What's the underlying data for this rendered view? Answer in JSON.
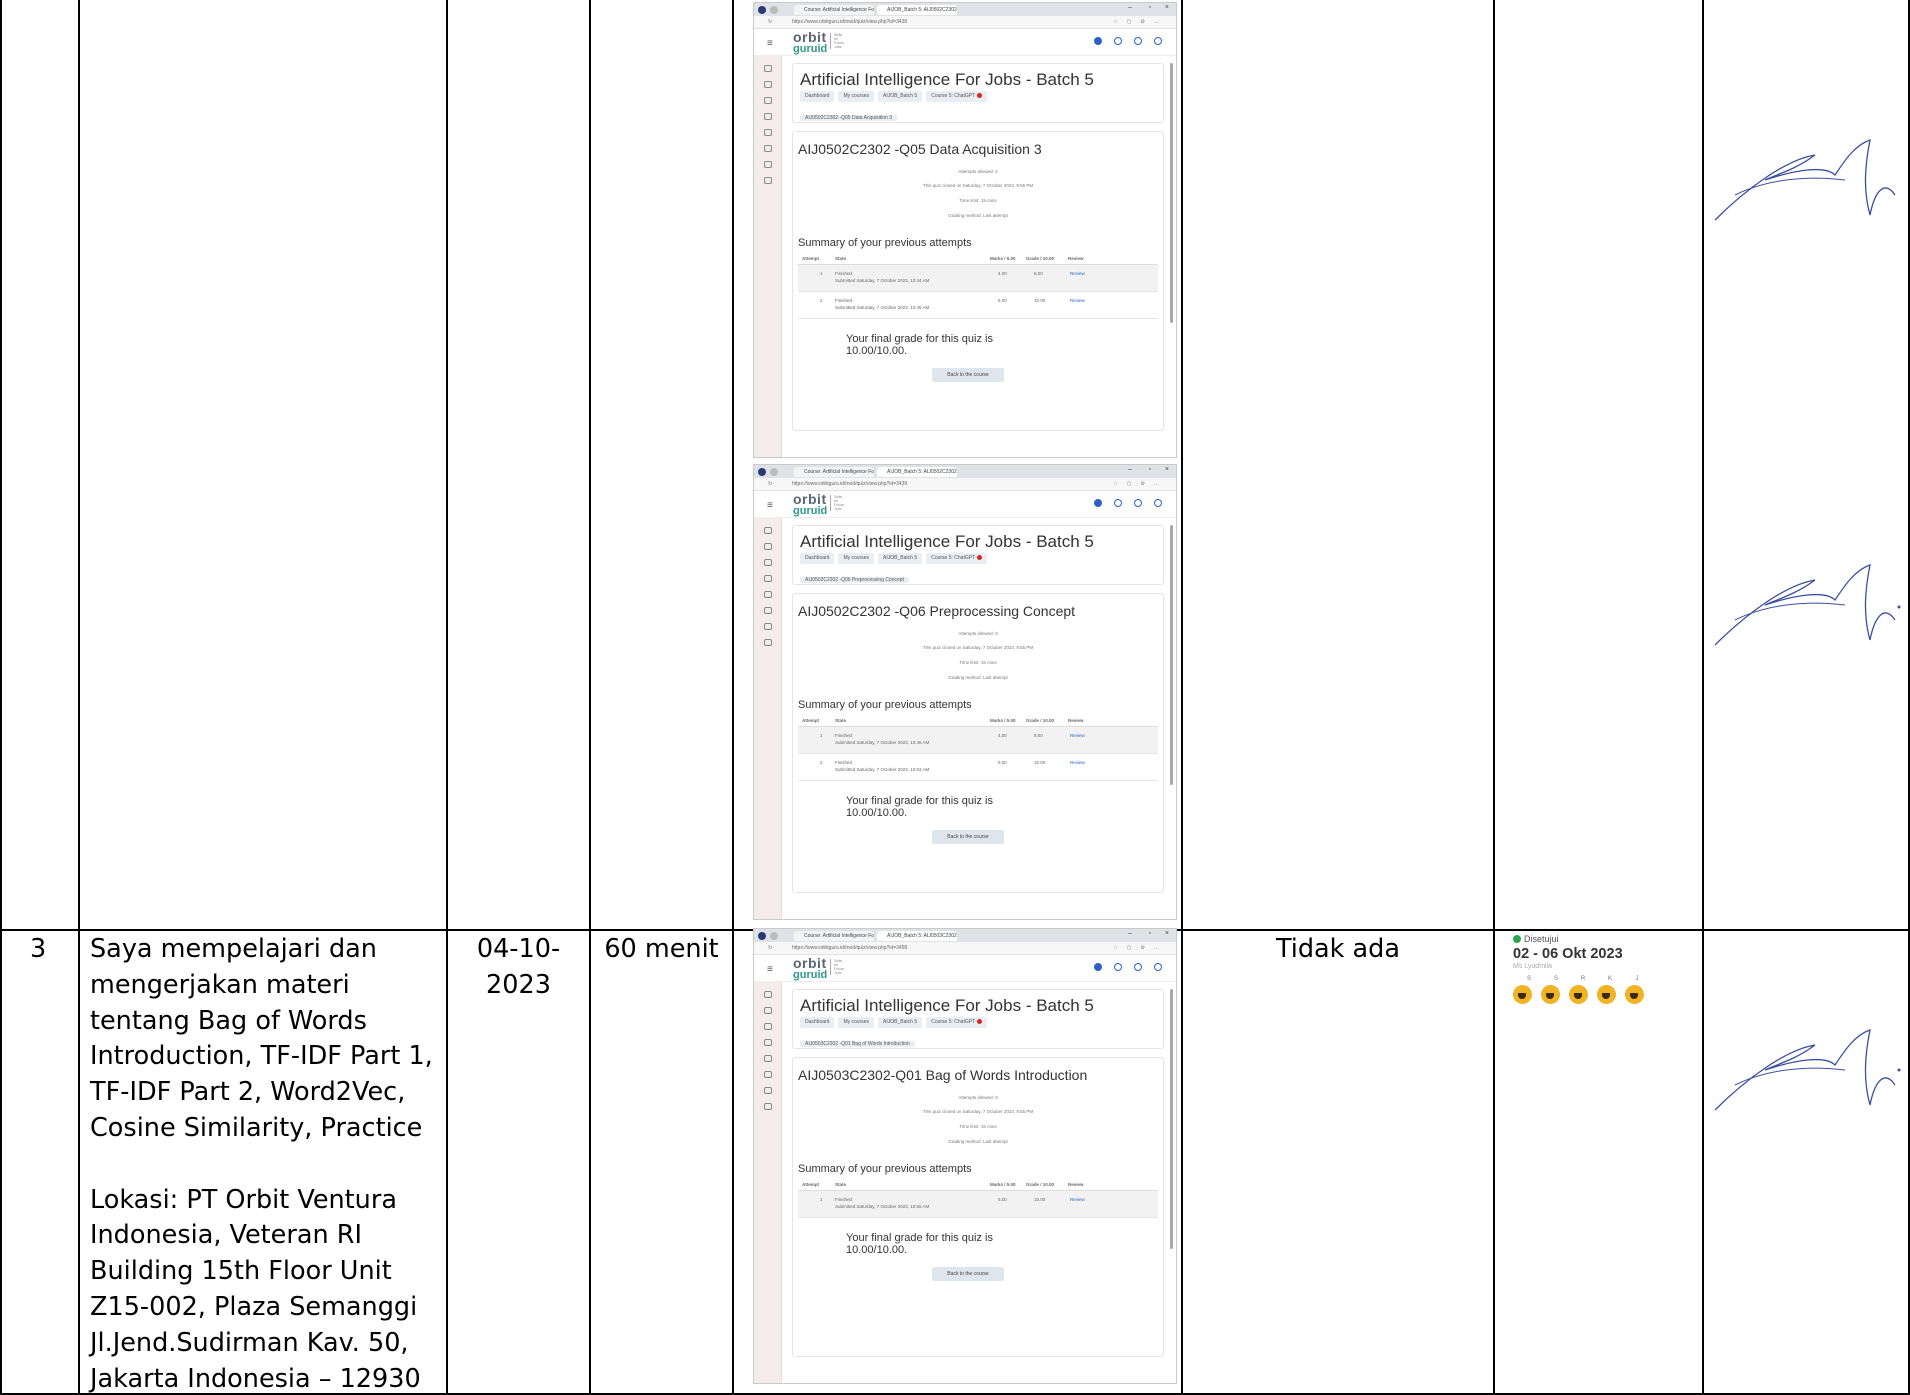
{
  "rows": {
    "row3": {
      "no": "3",
      "activity_lines": [
        "Saya mempelajari dan",
        "mengerjakan materi",
        "tentang Bag of Words",
        "Introduction, TF-IDF Part 1,",
        "TF-IDF Part 2, Word2Vec,",
        "Cosine Similarity, Practice"
      ],
      "location_lines": [
        "Lokasi: PT Orbit Ventura",
        "Indonesia, Veteran RI",
        "Building 15th Floor Unit",
        "Z15-002, Plaza Semanggi",
        "Jl.Jend.Sudirman Kav. 50,",
        "Jakarta Indonesia – 12930"
      ],
      "date_line1": "04-10-",
      "date_line2": "2023",
      "duration": "60 menit",
      "issues": "Tidak ada"
    }
  },
  "screenshots": [
    {
      "tab1": "Course: Artificial Intelligence For",
      "tab2": "AIJOB_Batch 5: AIJ0502C2302",
      "url": "https://www.orbitguru.id/mod/quiz/view.php?id=3438",
      "logo_top": "orbit",
      "logo_bottom": "guruid",
      "logo_tag": "Skills for Future Jobs",
      "course_title": "Artificial Intelligence For Jobs - Batch 5",
      "crumbs": [
        "Dashboard",
        "My courses",
        "AIJOB_Batch 5",
        "Course 5: ChatGPT"
      ],
      "crumb_quiz": "AIJ0502C2302 -Q05 Data Acquisition 3",
      "quiz_title": "AIJ0502C2302 -Q05 Data Acquisition 3",
      "info": [
        "Attempts allowed: 3",
        "This quiz closed on Saturday, 7 October 2023, 9:55 PM",
        "Time limit: 15 mins",
        "Grading method: Last attempt"
      ],
      "summary": "Summary of your previous attempts",
      "headers": [
        "Attempt",
        "State",
        "Marks / 5.00",
        "Grade / 10.00",
        "Review"
      ],
      "attempts": [
        {
          "n": "1",
          "state": "Finished",
          "submitted": "Submitted Saturday, 7 October 2023, 10:44 AM",
          "marks": "4.00",
          "grade": "8.00",
          "review": "Review"
        },
        {
          "n": "2",
          "state": "Finished",
          "submitted": "Submitted Saturday, 7 October 2023, 10:45 AM",
          "marks": "5.00",
          "grade": "10.00",
          "review": "Review"
        }
      ],
      "final1": "Your final grade for this quiz is",
      "final2": "10.00/10.00.",
      "back": "Back to the course"
    },
    {
      "tab1": "Course: Artificial Intelligence For",
      "tab2": "AIJOB_Batch 5: AIJ0502C2302",
      "url": "https://www.orbitguru.id/mod/quiz/view.php?id=3439",
      "logo_top": "orbit",
      "logo_bottom": "guruid",
      "logo_tag": "Skills for Future Jobs",
      "course_title": "Artificial Intelligence For Jobs - Batch 5",
      "crumbs": [
        "Dashboard",
        "My courses",
        "AIJOB_Batch 5",
        "Course 5: ChatGPT"
      ],
      "crumb_quiz": "AIJ0502C2302 -Q06 Preprocessing Concept",
      "quiz_title": "AIJ0502C2302 -Q06 Preprocessing Concept",
      "info": [
        "Attempts allowed: 3",
        "This quiz closed on Saturday, 7 October 2023, 9:55 PM",
        "Time limit: 15 mins",
        "Grading method: Last attempt"
      ],
      "summary": "Summary of your previous attempts",
      "headers": [
        "Attempt",
        "State",
        "Marks / 5.00",
        "Grade / 10.00",
        "Review"
      ],
      "attempts": [
        {
          "n": "1",
          "state": "Finished",
          "submitted": "Submitted Saturday, 7 October 2023, 10:46 AM",
          "marks": "4.00",
          "grade": "8.00",
          "review": "Review"
        },
        {
          "n": "2",
          "state": "Finished",
          "submitted": "Submitted Saturday, 7 October 2023, 10:53 AM",
          "marks": "5.00",
          "grade": "10.00",
          "review": "Review"
        }
      ],
      "final1": "Your final grade for this quiz is",
      "final2": "10.00/10.00.",
      "back": "Back to the course"
    },
    {
      "tab1": "Course: Artificial Intelligence For",
      "tab2": "AIJOB_Batch 5: AIJ0503C2302",
      "url": "https://www.orbitguru.id/mod/quiz/view.php?id=3458",
      "logo_top": "orbit",
      "logo_bottom": "guruid",
      "logo_tag": "Skills for Future Jobs",
      "course_title": "Artificial Intelligence For Jobs - Batch 5",
      "crumbs": [
        "Dashboard",
        "My courses",
        "AIJOB_Batch 5",
        "Course 5: ChatGPT"
      ],
      "crumb_quiz": "AIJ0503C2302 -Q01 Bag of Words Introduction",
      "quiz_title": "AIJ0503C2302-Q01 Bag of Words Introduction",
      "info": [
        "Attempts allowed: 3",
        "This quiz closed on Saturday, 7 October 2023, 9:55 PM",
        "Time limit: 15 mins",
        "Grading method: Last attempt"
      ],
      "summary": "Summary of your previous attempts",
      "headers": [
        "Attempt",
        "State",
        "Marks / 5.00",
        "Grade / 10.00",
        "Review"
      ],
      "attempts": [
        {
          "n": "1",
          "state": "Finished",
          "submitted": "Submitted Saturday, 7 October 2023, 10:55 AM",
          "marks": "5.00",
          "grade": "10.00",
          "review": "Review"
        }
      ],
      "final1": "Your final grade for this quiz is",
      "final2": "10.00/10.00.",
      "back": "Back to the course"
    }
  ],
  "attendance": {
    "status": "Disetujui",
    "date": "02 - 06 Okt 2023",
    "sub": "Ms Lyudmila",
    "days": [
      "S",
      "S",
      "R",
      "K",
      "J"
    ]
  },
  "colors": {
    "border": "#000000",
    "face": "#f0b323",
    "brand_green": "#2b9b86"
  }
}
